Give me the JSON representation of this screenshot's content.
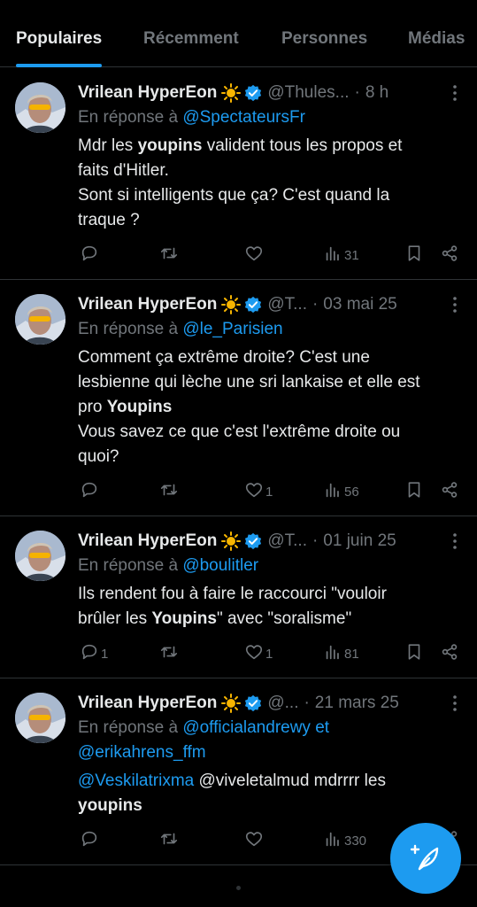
{
  "tabs": [
    {
      "label": "Populaires",
      "active": true
    },
    {
      "label": "Récemment",
      "active": false
    },
    {
      "label": "Personnes",
      "active": false
    },
    {
      "label": "Médias",
      "active": false
    }
  ],
  "colors": {
    "accent": "#1d9bf0",
    "background": "#000000",
    "muted": "#71767b",
    "text": "#e7e9ea"
  },
  "reply_prefix": "En réponse à",
  "tweets": [
    {
      "name": "Vrilean HyperEon",
      "handle": "@Thules...",
      "sep": "·",
      "time": "8 h",
      "reply_to": [
        "@SpectateursFr"
      ],
      "reply_join": "",
      "lines": [
        {
          "pre": "Mdr les ",
          "bold": "youpins",
          "post": " valident tous les propos et"
        },
        {
          "pre": "faits d'Hitler.",
          "bold": "",
          "post": ""
        },
        {
          "pre": "Sont si intelligents que ça? C'est quand la",
          "bold": "",
          "post": ""
        },
        {
          "pre": "traque ?",
          "bold": "",
          "post": ""
        }
      ],
      "replies": "",
      "retweets": "",
      "likes": "",
      "views": "31"
    },
    {
      "name": "Vrilean HyperEon",
      "handle": "@T...",
      "sep": "·",
      "time": "03 mai 25",
      "reply_to": [
        "@le_Parisien"
      ],
      "reply_join": "",
      "lines": [
        {
          "pre": "Comment ça extrême droite? C'est une",
          "bold": "",
          "post": ""
        },
        {
          "pre": "lesbienne qui lèche une sri lankaise et elle est",
          "bold": "",
          "post": ""
        },
        {
          "pre": "pro ",
          "bold": "Youpins",
          "post": ""
        },
        {
          "pre": "Vous savez ce que c'est l'extrême droite ou",
          "bold": "",
          "post": ""
        },
        {
          "pre": "quoi?",
          "bold": "",
          "post": ""
        }
      ],
      "replies": "",
      "retweets": "",
      "likes": "1",
      "views": "56"
    },
    {
      "name": "Vrilean HyperEon",
      "handle": "@T...",
      "sep": "·",
      "time": "01 juin 25",
      "reply_to": [
        "@boulitler"
      ],
      "reply_join": "",
      "lines": [
        {
          "pre": "Ils rendent fou à faire le raccourci \"vouloir",
          "bold": "",
          "post": ""
        },
        {
          "pre": "brûler les ",
          "bold": "Youpins",
          "post": "\" avec \"soralisme\""
        }
      ],
      "replies": "1",
      "retweets": "",
      "likes": "1",
      "views": "81"
    },
    {
      "name": "Vrilean HyperEon",
      "handle": "@...",
      "sep": "·",
      "time": "21 mars 25",
      "reply_to": [
        "@officialandrewy",
        "@erikahrens_ffm"
      ],
      "reply_join": "et",
      "lines": [
        {
          "mention": "@Veskilatrixma",
          "pre": " @viveletalmud mdrrrr les",
          "bold": "",
          "post": ""
        },
        {
          "pre": "",
          "bold": "youpins",
          "post": ""
        }
      ],
      "replies": "",
      "retweets": "",
      "likes": "",
      "views": "330"
    }
  ],
  "icons": {
    "sun": "sun-emoji-icon",
    "verified": "verified-badge-icon",
    "more": "more-vertical-icon",
    "reply": "reply-icon",
    "retweet": "retweet-icon",
    "like": "heart-icon",
    "views": "views-icon",
    "bookmark": "bookmark-icon",
    "share": "share-icon",
    "compose": "compose-feather-icon"
  }
}
